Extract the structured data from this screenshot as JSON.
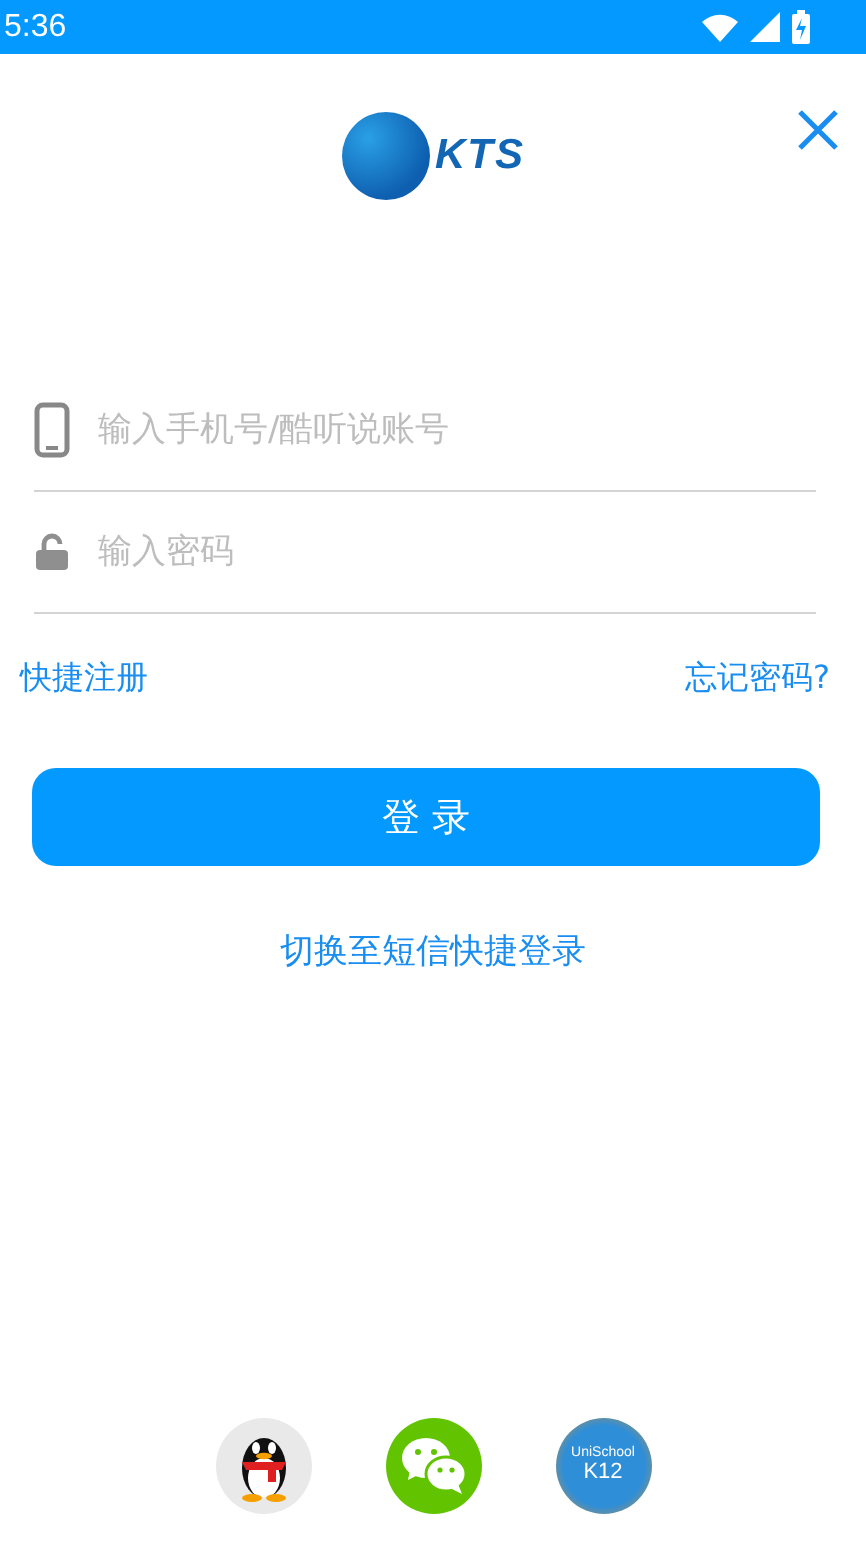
{
  "status_bar": {
    "time": "5:36"
  },
  "logo": {
    "text": "KTS"
  },
  "fields": [
    {
      "kind": "phone",
      "placeholder": "输入手机号/酷听说账号"
    },
    {
      "kind": "password",
      "placeholder": "输入密码"
    }
  ],
  "links": {
    "register": "快捷注册",
    "forgot": "忘记密码?"
  },
  "login_button": "登 录",
  "sms_login": "切换至短信快捷登录",
  "social": [
    {
      "kind": "qq"
    },
    {
      "kind": "wechat"
    },
    {
      "kind": "school",
      "text": "UniSchool",
      "subtext": "K12"
    }
  ]
}
